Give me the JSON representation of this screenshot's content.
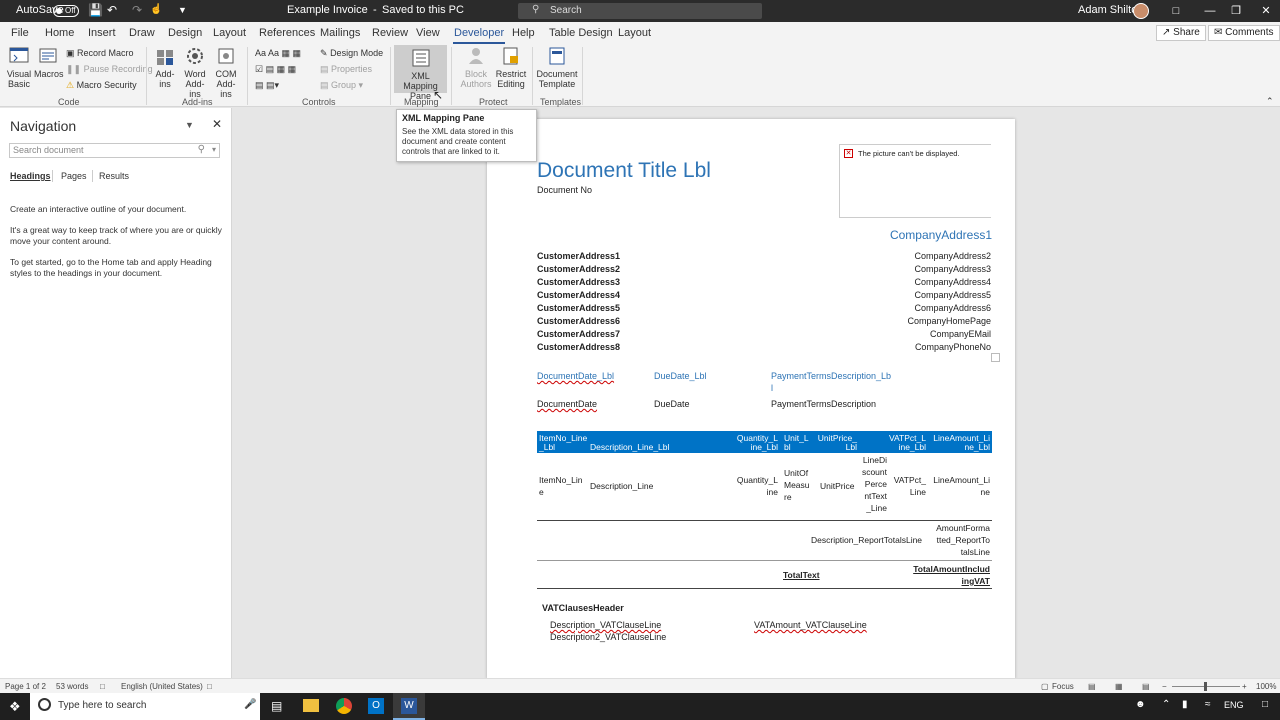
{
  "titlebar": {
    "autosave_label": "AutoSave",
    "autosave_state": "Off",
    "doc_title": "Example Invoice",
    "saved_status": "Saved to this PC",
    "search_placeholder": "Search",
    "user_name": "Adam Shilton"
  },
  "tabs": [
    "File",
    "Home",
    "Insert",
    "Draw",
    "Design",
    "Layout",
    "References",
    "Mailings",
    "Review",
    "View",
    "Developer",
    "Help",
    "Table Design",
    "Layout"
  ],
  "active_tab": "Developer",
  "share_label": "Share",
  "comments_label": "Comments",
  "ribbon": {
    "code": {
      "visual_basic": "Visual Basic",
      "macros": "Macros",
      "record_macro": "Record Macro",
      "pause_recording": "Pause Recording",
      "macro_security": "Macro Security",
      "group": "Code"
    },
    "addins": {
      "add_ins": "Add-ins",
      "word_add_ins": "Word Add-ins",
      "com_add_ins": "COM Add-ins",
      "group": "Add-ins"
    },
    "controls": {
      "design_mode": "Design Mode",
      "properties": "Properties",
      "group_btn": "Group",
      "group": "Controls"
    },
    "mapping": {
      "xml_mapping_pane": "XML Mapping Pane",
      "group": "Mapping"
    },
    "protect": {
      "block_authors": "Block Authors",
      "restrict_editing": "Restrict Editing",
      "group": "Protect"
    },
    "templates": {
      "document_template": "Document Template",
      "group": "Templates"
    }
  },
  "tooltip": {
    "title": "XML Mapping Pane",
    "desc": "See the XML data stored in this document and create content controls that are linked to it."
  },
  "navigation": {
    "title": "Navigation",
    "search_placeholder": "Search document",
    "tabs": [
      "Headings",
      "Pages",
      "Results"
    ],
    "paragraphs": [
      "Create an interactive outline of your document.",
      "It's a great way to keep track of where you are or quickly move your content around.",
      "To get started, go to the Home tab and apply Heading styles to the headings in your document."
    ]
  },
  "document": {
    "title": "Document Title Lbl",
    "doc_no": "Document No",
    "picture_error": "The picture can't be displayed.",
    "company_address1": "CompanyAddress1",
    "customer_addresses": [
      "CustomerAddress1",
      "CustomerAddress2",
      "CustomerAddress3",
      "CustomerAddress4",
      "CustomerAddress5",
      "CustomerAddress6",
      "CustomerAddress7",
      "CustomerAddress8"
    ],
    "company_lines": [
      "CompanyAddress2",
      "CompanyAddress3",
      "CompanyAddress4",
      "CompanyAddress5",
      "CompanyAddress6",
      "CompanyHomePage",
      "CompanyEMail",
      "CompanyPhoneNo"
    ],
    "labels": {
      "doc_date_lbl": "DocumentDate_Lbl",
      "due_date_lbl": "DueDate_Lbl",
      "payment_terms_lbl_1": "PaymentTermsDescription_Lb",
      "payment_terms_lbl_2": "l"
    },
    "values": {
      "doc_date": "DocumentDate",
      "due_date": "DueDate",
      "payment_terms": "PaymentTermsDescription"
    },
    "table_headers": {
      "item_no": [
        "ItemNo_Line",
        "_Lbl"
      ],
      "description": "Description_Line_Lbl",
      "quantity": [
        "Quantity_L",
        "ine_Lbl"
      ],
      "unit": [
        "Unit_L",
        "bl"
      ],
      "unit_price": [
        "UnitPrice_",
        "Lbl"
      ],
      "vat_pct": [
        "VATPct_L",
        "ine_Lbl"
      ],
      "line_amount": [
        "LineAmount_Li",
        "ne_Lbl"
      ]
    },
    "table_row": {
      "item_no": [
        "ItemNo_Lin",
        "e"
      ],
      "description": "Description_Line",
      "quantity": [
        "Quantity_L",
        "ine"
      ],
      "unit": [
        "UnitOf",
        "Measu",
        "re"
      ],
      "unit_price": "UnitPrice",
      "line_discount": [
        "LineDi",
        "scount",
        "Perce",
        "ntText",
        "_Line"
      ],
      "vat_pct": [
        "VATPct_",
        "Line"
      ],
      "line_amount": [
        "LineAmount_Li",
        "ne"
      ]
    },
    "totals": {
      "description": "Description_ReportTotalsLine",
      "amount": [
        "AmountForma",
        "tted_ReportTo",
        "talsLine"
      ],
      "total_text": "TotalText",
      "total_incl_vat": [
        "TotalAmountInclud",
        "ingVAT"
      ]
    },
    "vat_clauses": {
      "header": "VATClausesHeader",
      "description": "Description_VATClauseLine",
      "description2": "Description2_VATClauseLine",
      "amount": "VATAmount_VATClauseLine"
    }
  },
  "status": {
    "page": "Page 1 of 2",
    "words": "53 words",
    "language": "English (United States)",
    "focus": "Focus",
    "zoom": "100%"
  },
  "taskbar": {
    "search_placeholder": "Type here to search",
    "lang": "ENG"
  }
}
